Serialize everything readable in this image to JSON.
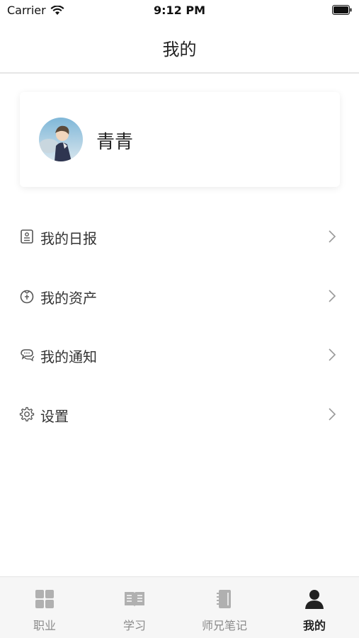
{
  "status_bar": {
    "carrier": "Carrier",
    "time": "9:12 PM"
  },
  "nav": {
    "title": "我的"
  },
  "profile": {
    "name": "青青"
  },
  "menu": {
    "items": [
      {
        "label": "我的日报",
        "icon": "report-icon"
      },
      {
        "label": "我的资产",
        "icon": "wallet-icon"
      },
      {
        "label": "我的通知",
        "icon": "chat-bubble-icon"
      },
      {
        "label": "设置",
        "icon": "gear-icon"
      }
    ]
  },
  "tabs": [
    {
      "label": "职业",
      "icon": "grid-icon",
      "active": false
    },
    {
      "label": "学习",
      "icon": "book-icon",
      "active": false
    },
    {
      "label": "师兄笔记",
      "icon": "notebook-icon",
      "active": false
    },
    {
      "label": "我的",
      "icon": "person-icon",
      "active": true
    }
  ],
  "colors": {
    "active_tab": "#222222",
    "inactive_tab": "#8a8a8a",
    "tab_bar_bg": "#f6f6f6"
  }
}
